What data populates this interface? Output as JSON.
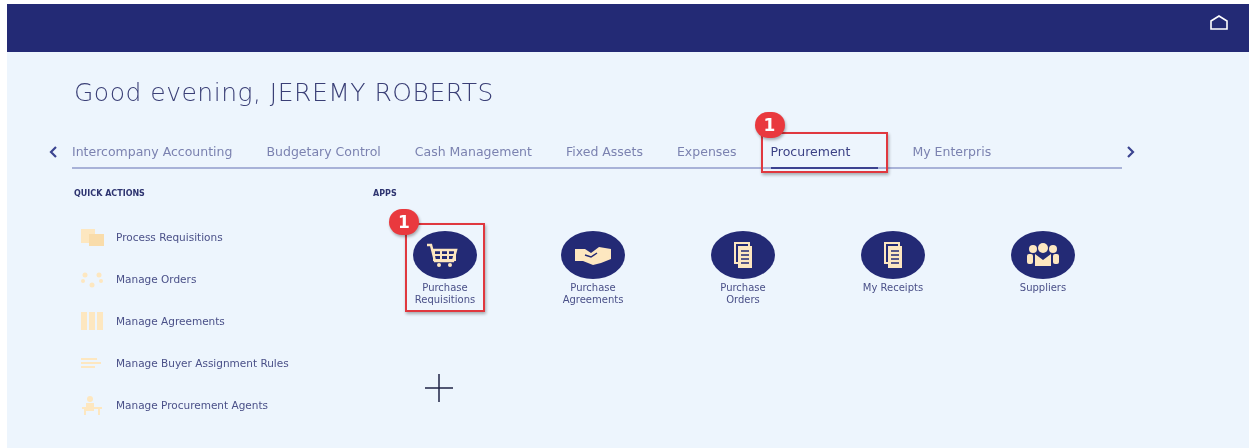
{
  "header": {
    "home_button": true
  },
  "greeting": "Good evening, JEREMY ROBERTS",
  "tabs": [
    {
      "label": "Intercompany Accounting",
      "selected": false
    },
    {
      "label": "Budgetary Control",
      "selected": false
    },
    {
      "label": "Cash Management",
      "selected": false
    },
    {
      "label": "Fixed Assets",
      "selected": false
    },
    {
      "label": "Expenses",
      "selected": false
    },
    {
      "label": "Procurement",
      "selected": true,
      "callout": "1"
    },
    {
      "label": "My Enterpris",
      "selected": false
    }
  ],
  "quick_actions": {
    "title": "QUICK ACTIONS",
    "items": [
      {
        "label": "Process Requisitions",
        "kind": "forms"
      },
      {
        "label": "Manage Orders",
        "kind": "cycle"
      },
      {
        "label": "Manage Agreements",
        "kind": "binders"
      },
      {
        "label": "Manage Buyer Assignment Rules",
        "kind": "lines"
      },
      {
        "label": "Manage Procurement Agents",
        "kind": "agent"
      }
    ]
  },
  "apps": {
    "title": "APPS",
    "items": [
      {
        "label": "Purchase Requisitions",
        "kind": "cart",
        "callout": "1"
      },
      {
        "label": "Purchase Agreements",
        "kind": "handshake"
      },
      {
        "label": "Purchase Orders",
        "kind": "document"
      },
      {
        "label": "My Receipts",
        "kind": "document"
      },
      {
        "label": "Suppliers",
        "kind": "people"
      }
    ]
  }
}
